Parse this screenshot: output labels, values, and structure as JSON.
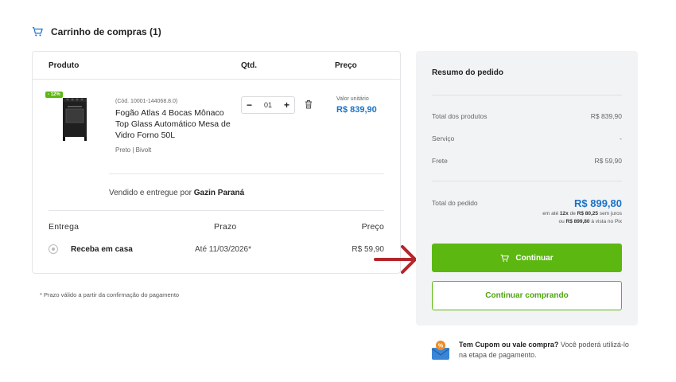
{
  "header": {
    "title": "Carrinho de compras (1)"
  },
  "cart_table": {
    "col_product": "Produto",
    "col_qty": "Qtd.",
    "col_price": "Preço"
  },
  "product": {
    "discount_badge": "- 12%",
    "code": "(Cód. 10001-144068.8.0)",
    "name": "Fogão Atlas 4 Bocas Mônaco Top Glass Automático Mesa de Vidro Forno 50L",
    "variant": "Preto | Bivolt",
    "qty": "01",
    "qty_minus": "−",
    "qty_plus": "+",
    "unit_label": "Valor unitário",
    "unit_price": "R$ 839,90",
    "seller_prefix": "Vendido e entregue por ",
    "seller_name": "Gazin Paraná"
  },
  "shipping": {
    "col_delivery": "Entrega",
    "col_deadline": "Prazo",
    "col_price": "Preço",
    "option_name": "Receba em casa",
    "option_date": "Até 11/03/2026*",
    "option_price": "R$ 59,90"
  },
  "footnote": "* Prazo válido a partir da confirmação do pagamento",
  "summary": {
    "title": "Resumo do pedido",
    "products_label": "Total dos produtos",
    "products_value": "R$ 839,90",
    "service_label": "Serviço",
    "service_value": "-",
    "freight_label": "Frete",
    "freight_value": "R$ 59,90",
    "total_label": "Total do pedido",
    "total_value": "R$ 899,80",
    "inst_prefix": "em até ",
    "inst_count": "12x",
    "inst_mid": " de ",
    "inst_value": "R$ 80,25",
    "inst_suffix": " sem juros",
    "pix_prefix": "ou ",
    "pix_value": "R$ 899,80",
    "pix_suffix": " à vista no Pix",
    "continue_label": "Continuar",
    "keep_shopping_label": "Continuar comprando"
  },
  "coupon": {
    "bold": "Tem Cupom ou vale compra?",
    "text": " Você poderá utilizá-lo na etapa de pagamento."
  },
  "colors": {
    "green": "#5cb811",
    "blue_price": "#1a73c8",
    "arrow_red": "#b3262b"
  }
}
